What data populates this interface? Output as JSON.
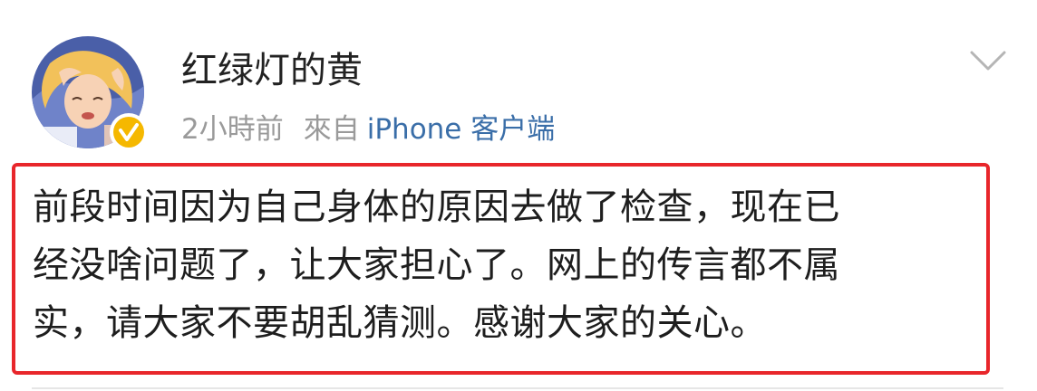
{
  "user": {
    "name": "红绿灯的黄",
    "verified": true
  },
  "meta": {
    "time": "2小時前",
    "from_label": "來自",
    "source": "iPhone 客户端"
  },
  "post": {
    "lines": [
      "前段时间因为自己身体的原因去做了检查，现在已",
      "经没啥问题了，让大家担心了。网上的传言都不属",
      "实，请大家不要胡乱猜测。感谢大家的关心。"
    ]
  },
  "icons": {
    "menu": "chevron-down-icon",
    "badge": "verified-badge-icon"
  },
  "colors": {
    "highlight_border": "#e8262b",
    "verified_badge": "#f5b800",
    "link": "#3a6ea8",
    "meta_text": "#9a9a9a"
  }
}
